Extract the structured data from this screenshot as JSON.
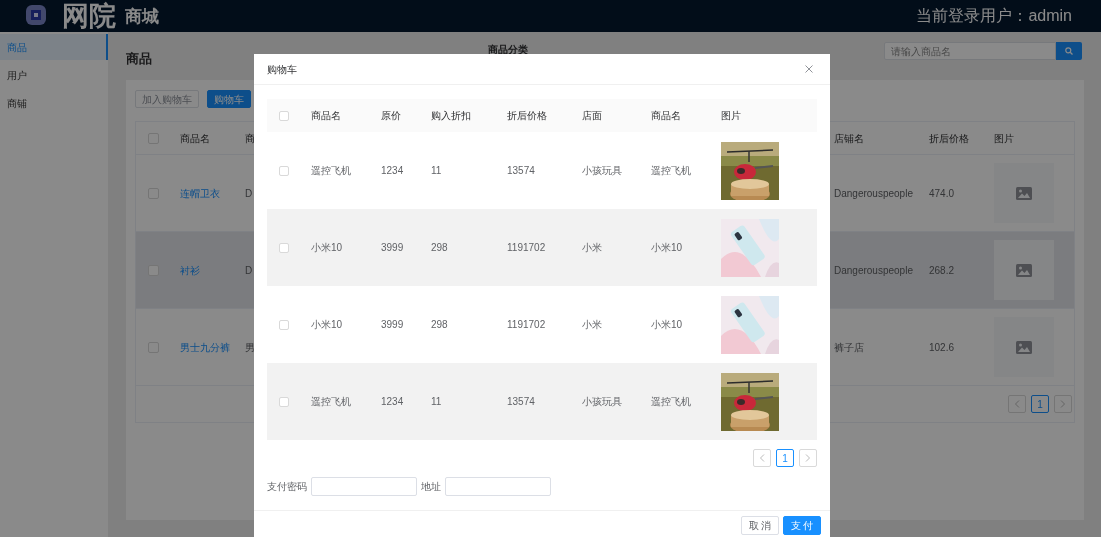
{
  "header": {
    "brand_main": "网院",
    "brand_sub": "商城",
    "user_label": "当前登录用户：admin"
  },
  "sidebar": {
    "items": [
      {
        "label": "商品",
        "selected": true
      },
      {
        "label": "用户",
        "selected": false
      },
      {
        "label": "商铺",
        "selected": false
      }
    ]
  },
  "page": {
    "title": "商品",
    "category_label": "商品分类",
    "search": {
      "placeholder": "请输入商品名"
    },
    "buttons": [
      {
        "label": "加入购物车",
        "disabled": true
      },
      {
        "label": "购物车",
        "disabled": false
      }
    ],
    "table": {
      "select_all_checked": false,
      "columns_left": [
        "商品名",
        "商"
      ],
      "columns_right": [
        "店铺名",
        "折后价格",
        "图片"
      ],
      "rows": [
        {
          "checked": false,
          "hovered": false,
          "name": "连帽卫衣",
          "column_3": "D",
          "shop": "Dangerouspeople",
          "price": "474.0"
        },
        {
          "checked": false,
          "hovered": true,
          "name": "衬衫",
          "column_3": "D",
          "shop": "Dangerouspeople",
          "price": "268.2"
        },
        {
          "checked": false,
          "hovered": false,
          "name": "男士九分裤",
          "column_3": "男",
          "shop": "裤子店",
          "price": "102.6"
        }
      ]
    },
    "pagination": {
      "pages": [
        {
          "label": "1",
          "selected": true
        }
      ]
    }
  },
  "cart_dialog": {
    "title": "购物车",
    "select_all_checked": false,
    "columns": [
      "商品名",
      "原价",
      "购入折扣",
      "折后价格",
      "店面",
      "商品名",
      "图片"
    ],
    "rows": [
      {
        "checked": false,
        "name": "遥控飞机",
        "price": "1234",
        "discount": "11",
        "final_price": "13574",
        "shop": "小孩玩具",
        "product": "遥控飞机"
      },
      {
        "checked": false,
        "name": "小米10",
        "price": "3999",
        "discount": "298",
        "final_price": "1191702",
        "shop": "小米",
        "product": "小米10"
      },
      {
        "checked": false,
        "name": "小米10",
        "price": "3999",
        "discount": "298",
        "final_price": "1191702",
        "shop": "小米",
        "product": "小米10"
      },
      {
        "checked": false,
        "name": "遥控飞机",
        "price": "1234",
        "discount": "11",
        "final_price": "13574",
        "shop": "小孩玩具",
        "product": "遥控飞机"
      }
    ],
    "pagination": {
      "pages": [
        {
          "label": "1",
          "selected": true
        }
      ]
    },
    "form": [
      {
        "label": "支付密码"
      },
      {
        "label": "地址"
      }
    ],
    "buttons": [
      {
        "label": "取 消",
        "kind": "secondary"
      },
      {
        "label": "支 付",
        "kind": "primary"
      }
    ]
  }
}
